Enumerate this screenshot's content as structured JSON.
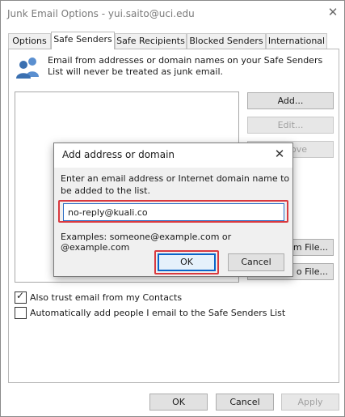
{
  "window": {
    "title": "Junk Email Options - yui.saito@uci.edu",
    "tabs": [
      "Options",
      "Safe Senders",
      "Safe Recipients",
      "Blocked Senders",
      "International"
    ],
    "active_tab": "Safe Senders"
  },
  "safe_senders": {
    "description": "Email from addresses or domain names on your Safe Senders List will never be treated as junk email.",
    "list_items": [],
    "buttons": {
      "add": "Add...",
      "edit": "Edit...",
      "remove": "ove",
      "import": "om File...",
      "export": "o File..."
    },
    "options": [
      {
        "label": "Also trust email from my Contacts",
        "checked": true
      },
      {
        "label": "Automatically add people I email to the Safe Senders List",
        "checked": false
      }
    ]
  },
  "footer": {
    "ok": "OK",
    "cancel": "Cancel",
    "apply": "Apply"
  },
  "dialog": {
    "title": "Add address or domain",
    "instruction": "Enter an email address or Internet domain name to be added to the list.",
    "input_value": "no-reply@kuali.co",
    "examples": "Examples: someone@example.com or @example.com",
    "ok": "OK",
    "cancel": "Cancel"
  },
  "icons": {
    "window_close": "close-icon",
    "dialog_close": "close-icon",
    "info": "people-icon"
  },
  "colors": {
    "highlight": "#d9393f",
    "accent": "#0a64c8"
  }
}
